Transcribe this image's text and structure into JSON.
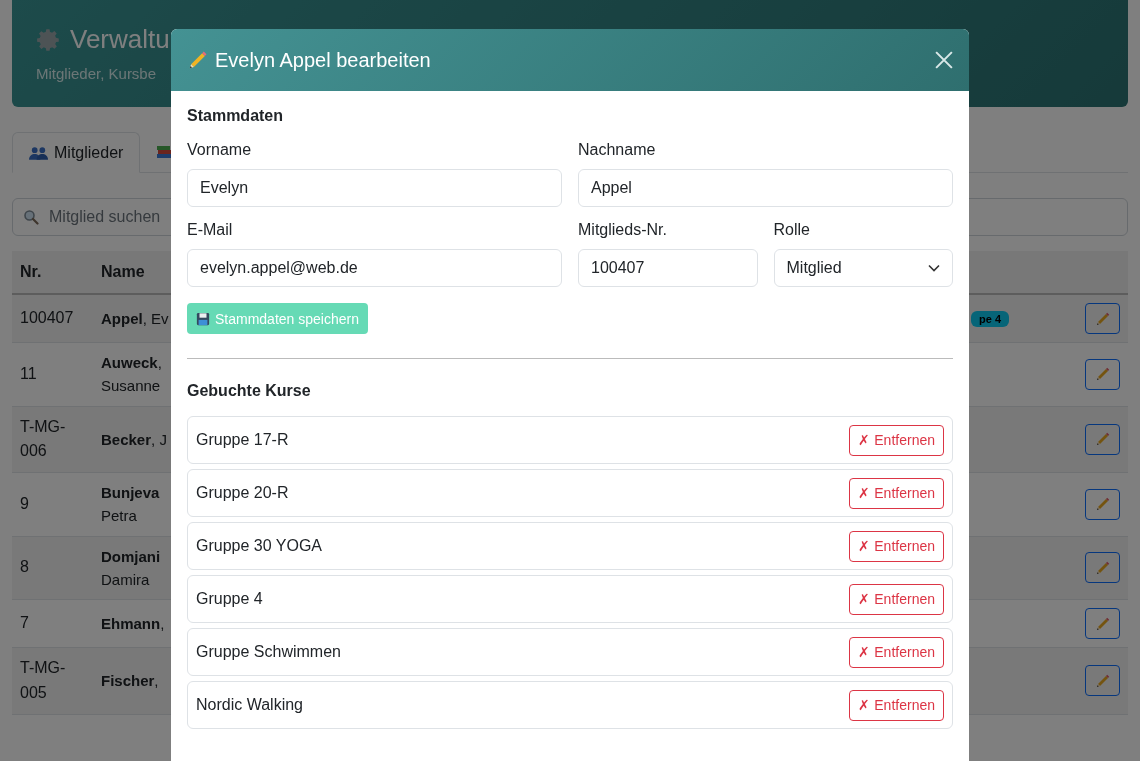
{
  "header": {
    "title": "Verwaltu",
    "subtitle": "Mitglieder, Kursbe"
  },
  "tabs": [
    {
      "label": "Mitglieder",
      "selected": true
    },
    {
      "selected": false
    }
  ],
  "search": {
    "placeholder": "Mitglied suchen"
  },
  "table": {
    "columns": [
      "Nr.",
      "Name"
    ],
    "rows": [
      {
        "nr": "100407",
        "name": "**Appel**, Ev",
        "badge": "pe 4"
      },
      {
        "nr": "11",
        "name": "**Auweck**, Susanne"
      },
      {
        "nr": "T-MG-006",
        "name": "**Becker**, J"
      },
      {
        "nr": "9",
        "name": "**Bunjeva** Petra"
      },
      {
        "nr": "8",
        "name": "**Domjani** Damira"
      },
      {
        "nr": "7",
        "name": "**Ehmann**,"
      },
      {
        "nr": "T-MG-005",
        "name": "**Fischer**,"
      }
    ]
  },
  "modal": {
    "title": "Evelyn Appel bearbeiten",
    "section_1": "Stammdaten",
    "fields": [
      {
        "label": "Vorname",
        "value": "Evelyn",
        "kind": "input"
      },
      {
        "label": "Nachname",
        "value": "Appel",
        "kind": "input"
      },
      {
        "label": "E-Mail",
        "value": "evelyn.appel@web.de",
        "kind": "input"
      },
      {
        "label": "Mitglieds-Nr.",
        "value": "100407",
        "kind": "input"
      },
      {
        "label": "Rolle",
        "value": "Mitglied",
        "kind": "select"
      }
    ],
    "save_button": "Stammdaten speichern",
    "section_2": "Gebuchte Kurse",
    "courses": [
      {
        "name": "Gruppe 17-R",
        "action": "✗ Entfernen"
      },
      {
        "name": "Gruppe 20-R",
        "action": "✗ Entfernen"
      },
      {
        "name": "Gruppe 30 YOGA",
        "action": "✗ Entfernen"
      },
      {
        "name": "Gruppe 4",
        "action": "✗ Entfernen"
      },
      {
        "name": "Gruppe Schwimmen",
        "action": "✗ Entfernen"
      },
      {
        "name": "Nordic Walking",
        "action": "✗ Entfernen"
      }
    ]
  }
}
